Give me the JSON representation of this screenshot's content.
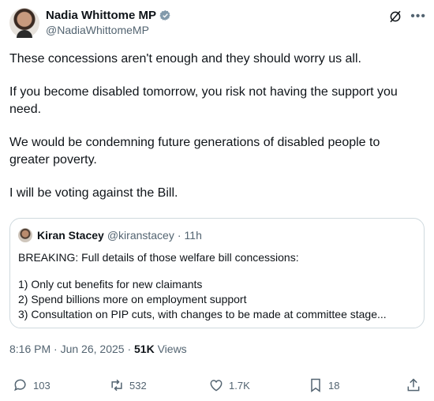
{
  "author": {
    "name": "Nadia Whittome MP",
    "handle": "@NadiaWhittomeMP"
  },
  "tweet": {
    "paragraphs": [
      "These concessions aren't enough and they should worry us all.",
      "If you become disabled tomorrow, you risk not having the support you need.",
      "We would be condemning future generations of disabled people to greater poverty.",
      "I will be voting against the Bill."
    ]
  },
  "quoted": {
    "name": "Kiran Stacey",
    "handle": "@kiranstacey",
    "time": "11h",
    "lines": [
      "BREAKING: Full details of those welfare bill concessions:",
      "1) Only cut benefits for new claimants",
      "2) Spend billions more on employment support",
      "3) Consultation on PIP cuts, with changes to be made at committee stage..."
    ]
  },
  "meta": {
    "time": "8:16 PM",
    "date": "Jun 26, 2025",
    "views_count": "51K",
    "views_label": "Views"
  },
  "actions": {
    "replies": "103",
    "reposts": "532",
    "likes": "1.7K",
    "bookmarks": "18"
  },
  "colors": {
    "secondary": "#536471",
    "verified": "#829aab",
    "border": "#cfd9de"
  }
}
